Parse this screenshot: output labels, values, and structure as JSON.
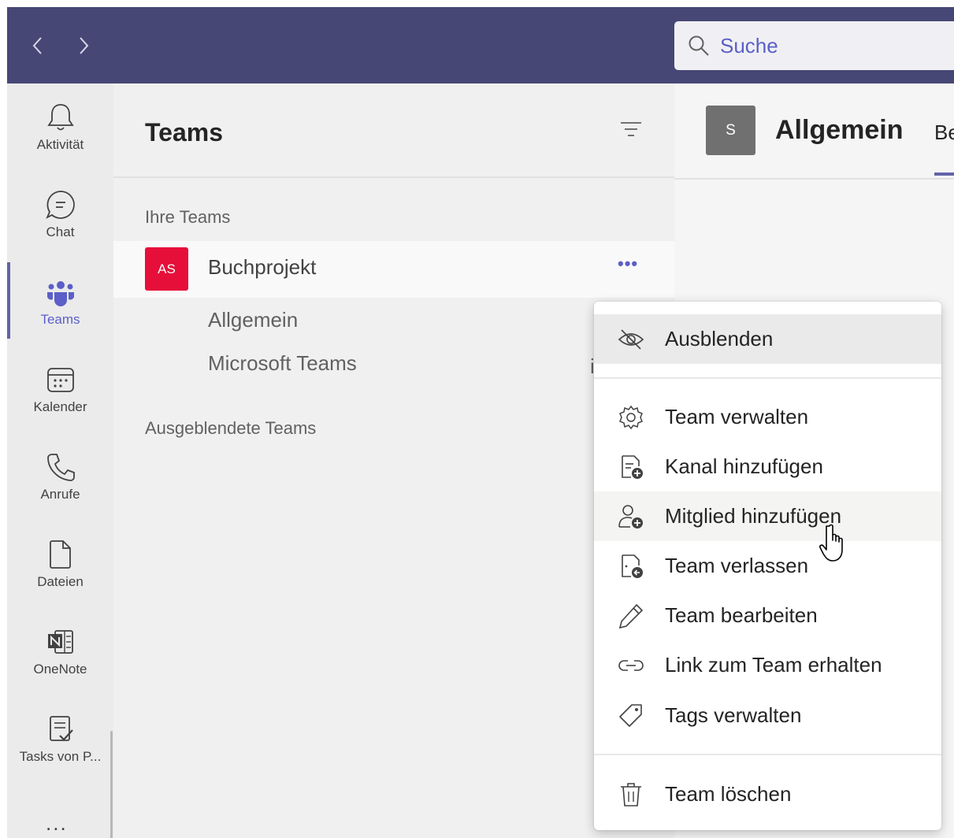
{
  "search": {
    "placeholder": "Suche"
  },
  "rail": {
    "items": [
      {
        "label": "Aktivität",
        "icon": "bell-icon"
      },
      {
        "label": "Chat",
        "icon": "chat-icon"
      },
      {
        "label": "Teams",
        "icon": "teams-icon",
        "active": true
      },
      {
        "label": "Kalender",
        "icon": "calendar-icon"
      },
      {
        "label": "Anrufe",
        "icon": "phone-icon"
      },
      {
        "label": "Dateien",
        "icon": "file-icon"
      },
      {
        "label": "OneNote",
        "icon": "onenote-icon"
      },
      {
        "label": "Tasks von P...",
        "icon": "tasks-icon"
      }
    ],
    "more": "..."
  },
  "teams_panel": {
    "title": "Teams",
    "your_teams_label": "Ihre Teams",
    "team": {
      "avatar_initials": "AS",
      "avatar_color": "#e60f3a",
      "name": "Buchprojekt",
      "more": "•••"
    },
    "channels": [
      "Allgemein",
      "Microsoft Teams"
    ],
    "hidden_teams_label": "Ausgeblendete Teams",
    "truncated_char": "i"
  },
  "channel_header": {
    "avatar_initial": "S",
    "title": "Allgemein",
    "tab_partial": "Be"
  },
  "context_menu": {
    "items": [
      {
        "label": "Ausblenden",
        "icon": "hide-eye-icon"
      },
      {
        "label": "Team verwalten",
        "icon": "gear-icon"
      },
      {
        "label": "Kanal hinzufügen",
        "icon": "add-channel-icon"
      },
      {
        "label": "Mitglied hinzufügen",
        "icon": "add-member-icon"
      },
      {
        "label": "Team verlassen",
        "icon": "leave-team-icon"
      },
      {
        "label": "Team bearbeiten",
        "icon": "pencil-icon"
      },
      {
        "label": "Link zum Team erhalten",
        "icon": "link-icon"
      },
      {
        "label": "Tags verwalten",
        "icon": "tag-icon"
      },
      {
        "label": "Team löschen",
        "icon": "trash-icon"
      }
    ]
  },
  "colors": {
    "titlebar": "#464775",
    "accent": "#6264a7",
    "accent_text": "#5b5fc7"
  }
}
